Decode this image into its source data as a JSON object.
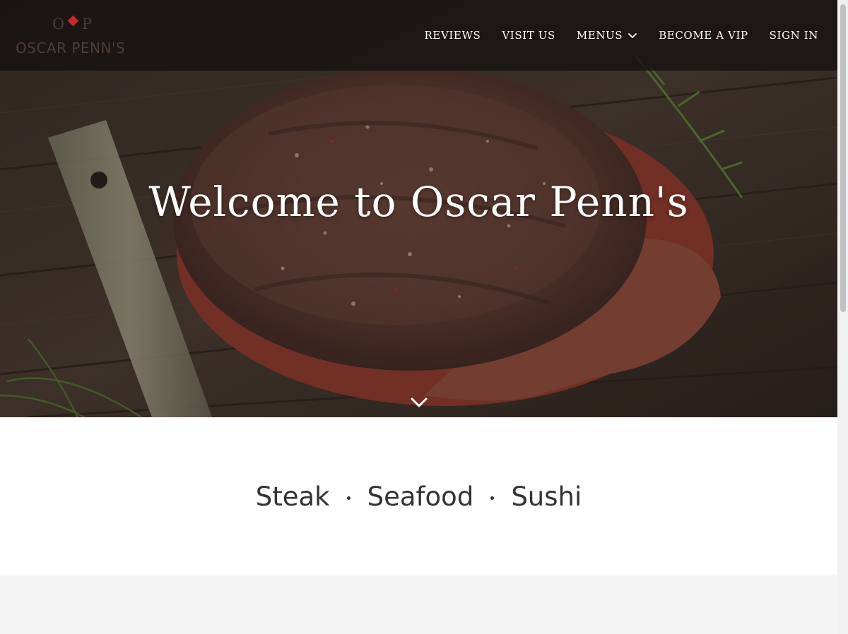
{
  "brand": {
    "monogram_left": "O",
    "monogram_right": "P",
    "name": "OSCAR PENN'S",
    "accent_color": "#c8282f"
  },
  "nav": {
    "items": [
      {
        "label": "REVIEWS"
      },
      {
        "label": "VISIT US"
      },
      {
        "label": "MENUS",
        "has_dropdown": true
      },
      {
        "label": "BECOME A VIP"
      },
      {
        "label": "SIGN IN"
      }
    ]
  },
  "hero": {
    "headline": "Welcome to Oscar Penn's",
    "scroll_icon": "chevron-down-icon"
  },
  "tagline": {
    "items": [
      "Steak",
      "Seafood",
      "Sushi"
    ]
  }
}
